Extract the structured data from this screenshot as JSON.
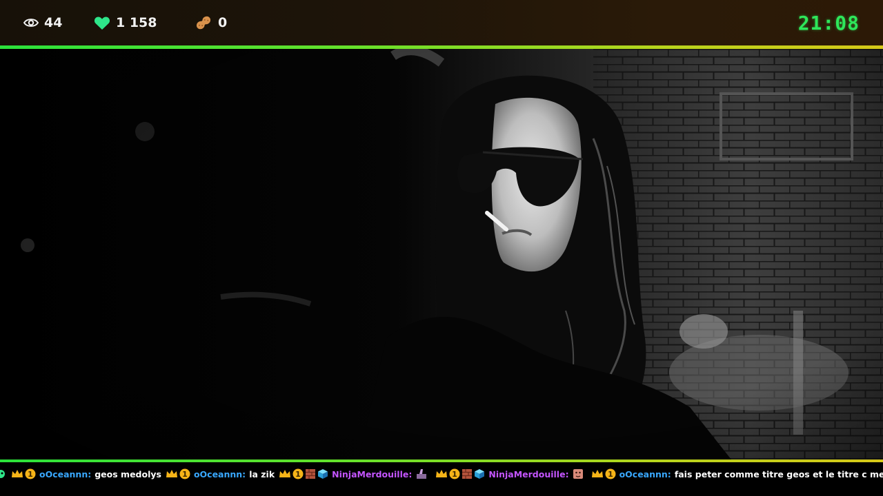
{
  "overlay": {
    "viewers": "44",
    "followers": "1 158",
    "peanuts": "0",
    "clock": "21:08",
    "colors": {
      "accent_start": "#2be23b",
      "accent_end": "#d6c818",
      "clock": "#2ee65a",
      "heart": "#2ee68a",
      "user_cyan": "#39a8ff",
      "user_purple": "#c455ff"
    },
    "icons": {
      "viewers": "eye-icon",
      "followers": "heart-icon",
      "peanuts": "peanut-icon"
    }
  },
  "chat": {
    "messages": [
      {
        "user": "oOceannn:",
        "text": "geos medolys"
      },
      {
        "user": "oOceannn:",
        "text": "la zik"
      },
      {
        "user": "NinjaMerdouille:",
        "text": ""
      },
      {
        "user": "NinjaMerdouille:",
        "text": ""
      },
      {
        "user": "oOceannn:",
        "text": "fais peter comme titre geos et le titre c medolys"
      }
    ],
    "badges": [
      "crown-badge",
      "one-badge",
      "brick-badge",
      "cube-badge"
    ],
    "emotes": [
      "emote-thumbs",
      "emote-face"
    ]
  }
}
